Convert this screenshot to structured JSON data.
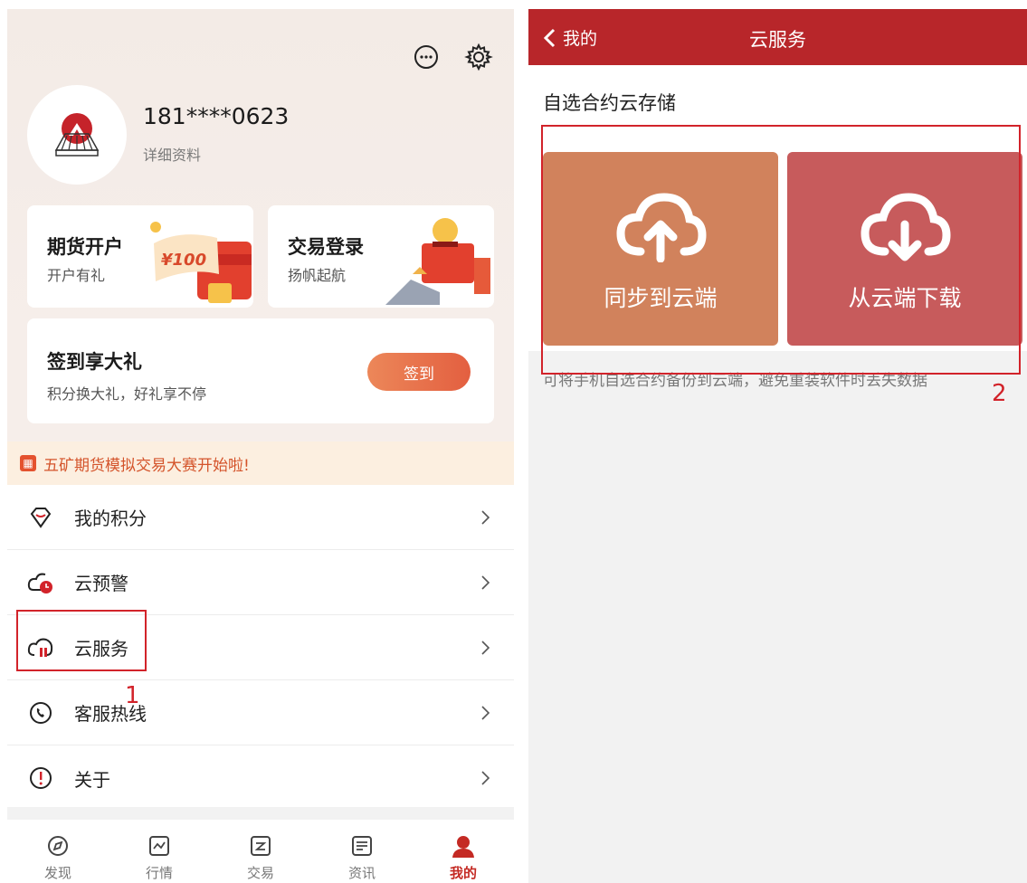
{
  "left": {
    "profile": {
      "phone": "181****0623",
      "detail_link": "详细资料"
    },
    "cards": {
      "futures": {
        "title": "期货开户",
        "subtitle": "开户有礼",
        "promo": "¥100"
      },
      "trade_login": {
        "title": "交易登录",
        "subtitle": "扬帆起航"
      },
      "checkin": {
        "title": "签到享大礼",
        "subtitle": "积分换大礼，好礼享不停",
        "button": "签到"
      }
    },
    "banner": {
      "text": "五矿期货模拟交易大赛开始啦!"
    },
    "menu": [
      {
        "label": "我的积分",
        "icon": "points-icon"
      },
      {
        "label": "云预警",
        "icon": "cloud-alert-icon"
      },
      {
        "label": "云服务",
        "icon": "cloud-service-icon"
      },
      {
        "label": "客服热线",
        "icon": "phone-icon"
      },
      {
        "label": "关于",
        "icon": "info-icon"
      }
    ],
    "tabs": [
      {
        "label": "发现",
        "icon": "compass-icon"
      },
      {
        "label": "行情",
        "icon": "chart-icon"
      },
      {
        "label": "交易",
        "icon": "trade-icon"
      },
      {
        "label": "资讯",
        "icon": "news-icon"
      },
      {
        "label": "我的",
        "icon": "person-icon",
        "active": true
      }
    ],
    "annotation": "1"
  },
  "right": {
    "nav": {
      "back_label": "我的",
      "title": "云服务"
    },
    "section_title": "自选合约云存储",
    "buttons": {
      "upload": "同步到云端",
      "download": "从云端下载"
    },
    "hint": "可将手机自选合约备份到云端，避免重装软件时丢失数据",
    "annotation": "2"
  },
  "colors": {
    "brand_red": "#b8262a",
    "upload_bg": "#d1825c",
    "download_bg": "#c75b5c",
    "annotation_red": "#d2232a"
  }
}
